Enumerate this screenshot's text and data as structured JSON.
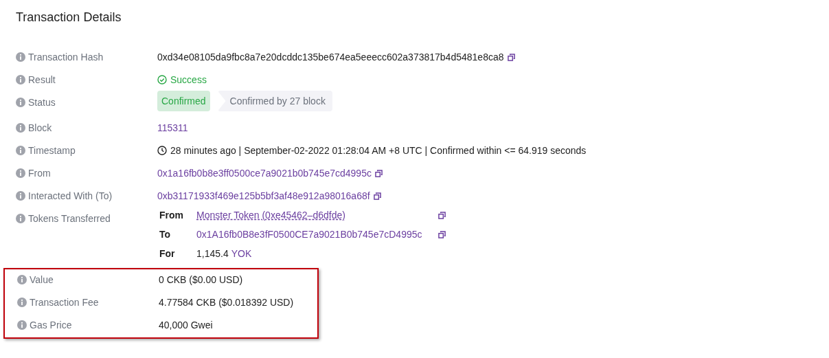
{
  "title": "Transaction Details",
  "rows": [
    {
      "label": "Transaction Hash",
      "kind": "text",
      "value": "0xd34e08105da9fbc8a7e20dcddc135be674ea5eeecc602a373817b4d5481e8ca8",
      "copy": true
    },
    {
      "label": "Result",
      "kind": "success",
      "value": "Success"
    },
    {
      "label": "Status",
      "kind": "status",
      "badge": "Confirmed",
      "detail": "Confirmed by 27 block"
    },
    {
      "label": "Block",
      "kind": "link",
      "value": "115311"
    },
    {
      "label": "Timestamp",
      "kind": "timestamp",
      "value": "28 minutes ago | September-02-2022 01:28:04 AM +8 UTC | Confirmed within <= 64.919 seconds"
    },
    {
      "label": "From",
      "kind": "link",
      "value": "0x1a16fb0b8e3ff0500ce7a9021b0b745e7cd4995c",
      "copy": true
    },
    {
      "label": "Interacted With (To)",
      "kind": "link",
      "value": "0xb31171933f469e125b5bf3af48e912a98016a68f",
      "copy": true
    },
    {
      "label": "Tokens Transferred",
      "kind": "tokens",
      "items": [
        {
          "key": "From",
          "value": "Monster Token (0xe45462–d6dfde)",
          "kind": "token",
          "copy": true
        },
        {
          "key": "To",
          "value": "0x1A16fb0B8e3fF0500CE7a9021B0b745e7cD4995c",
          "kind": "link",
          "copy": true
        },
        {
          "key": "For",
          "value": "1,145.4",
          "unit": "YOK",
          "kind": "amount"
        }
      ]
    }
  ],
  "highlighted_rows": [
    {
      "label": "Value",
      "kind": "text",
      "value": "0 CKB ($0.00 USD)"
    },
    {
      "label": "Transaction Fee",
      "kind": "text",
      "value": "4.77584 CKB ($0.018392 USD)"
    },
    {
      "label": "Gas Price",
      "kind": "text",
      "value": "40,000 Gwei"
    }
  ]
}
